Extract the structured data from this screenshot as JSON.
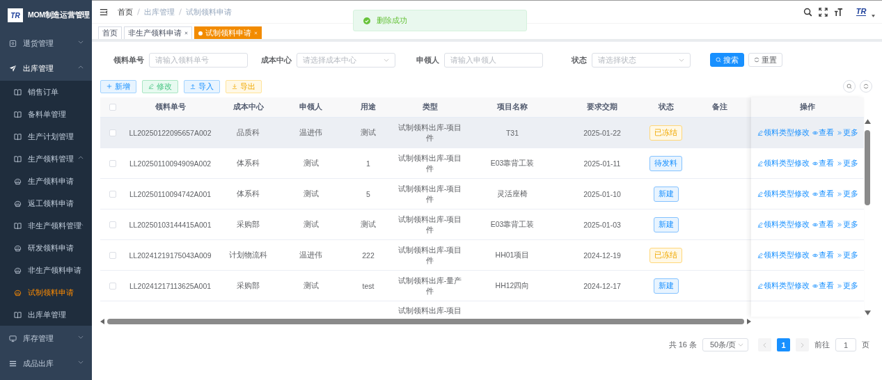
{
  "sidebar": {
    "logo_text": "TR",
    "title": "MOM制造运营管理",
    "items": [
      {
        "label": "退货管理",
        "expanded": false,
        "selected": false
      },
      {
        "label": "出库管理",
        "expanded": true,
        "selected": false,
        "children": [
          {
            "label": "销售订单",
            "selected": false
          },
          {
            "label": "备料单管理",
            "selected": false
          },
          {
            "label": "生产计划管理",
            "selected": false
          },
          {
            "label": "生产领料管理",
            "expanded": true,
            "selected": false,
            "children": [
              {
                "label": "生产领料申请",
                "selected": false
              },
              {
                "label": "返工领料申请",
                "selected": false
              }
            ]
          },
          {
            "label": "非生产领料管理",
            "expanded": true,
            "selected": false,
            "children": [
              {
                "label": "研发领料申请",
                "selected": false
              },
              {
                "label": "非生产领料申请",
                "selected": false
              },
              {
                "label": "试制领料申请",
                "selected": true
              }
            ]
          },
          {
            "label": "出库单管理",
            "selected": false
          }
        ]
      },
      {
        "label": "库存管理",
        "expanded": false,
        "selected": false
      },
      {
        "label": "成品出库",
        "expanded": false,
        "selected": false
      }
    ]
  },
  "header": {
    "breadcrumbs": [
      "首页",
      "出库管理",
      "试制领料申请"
    ],
    "avatar_text": "TR"
  },
  "tags": [
    {
      "label": "首页",
      "closable": false,
      "selected": false
    },
    {
      "label": "非生产领料申请",
      "closable": true,
      "selected": false
    },
    {
      "label": "试制领料申请",
      "closable": true,
      "selected": true
    }
  ],
  "toast": {
    "message": "删除成功"
  },
  "filters": [
    {
      "label": "领料单号",
      "kind": "input",
      "placeholder": "请输入领料单号"
    },
    {
      "label": "成本中心",
      "kind": "select",
      "placeholder": "请选择成本中心"
    },
    {
      "label": "申领人",
      "kind": "input",
      "placeholder": "请输入申领人"
    },
    {
      "label": "状态",
      "kind": "select",
      "placeholder": "请选择状态"
    }
  ],
  "filter_buttons": [
    {
      "label": "搜索",
      "kind": "primary"
    },
    {
      "label": "重置",
      "kind": "default"
    }
  ],
  "toolbar": [
    {
      "label": "新增",
      "kind": "add"
    },
    {
      "label": "修改",
      "kind": "edit"
    },
    {
      "label": "导入",
      "kind": "import"
    },
    {
      "label": "导出",
      "kind": "export"
    }
  ],
  "table": {
    "all_checked": false,
    "columns": [
      "领料单号",
      "成本中心",
      "申领人",
      "用途",
      "类型",
      "项目名称",
      "要求交期",
      "状态",
      "备注",
      "操作"
    ],
    "rows": [
      {
        "checked": false,
        "highlighted": true,
        "code": "LL20250122095657A002",
        "cost_center": "品质科",
        "applicant": "温进伟",
        "use": "测试",
        "type": "试制领料出库-项目件",
        "project": "T31",
        "due": "2025-01-22",
        "status": {
          "text": "已冻结",
          "kind": "warning"
        },
        "actions": [
          "领料类型修改",
          "查看",
          "更多"
        ]
      },
      {
        "checked": false,
        "highlighted": false,
        "code": "LL20250110094909A002",
        "cost_center": "体系科",
        "applicant": "测试",
        "use": "1",
        "type": "试制领料出库-项目件",
        "project": "E03靠背工装",
        "due": "2025-01-11",
        "status": {
          "text": "待发料",
          "kind": "primary"
        },
        "actions": [
          "领料类型修改",
          "查看",
          "更多"
        ]
      },
      {
        "checked": false,
        "highlighted": false,
        "code": "LL20250110094742A001",
        "cost_center": "体系科",
        "applicant": "测试",
        "use": "5",
        "type": "试制领料出库-项目件",
        "project": "灵活座椅",
        "due": "2025-01-10",
        "status": {
          "text": "新建",
          "kind": "primary"
        },
        "actions": [
          "领料类型修改",
          "查看",
          "更多"
        ]
      },
      {
        "checked": false,
        "highlighted": false,
        "code": "LL20250103144415A001",
        "cost_center": "采购部",
        "applicant": "测试",
        "use": "测试",
        "type": "试制领料出库-项目件",
        "project": "E03靠背工装",
        "due": "2025-01-03",
        "status": {
          "text": "新建",
          "kind": "primary"
        },
        "actions": [
          "领料类型修改",
          "查看",
          "更多"
        ]
      },
      {
        "checked": false,
        "highlighted": false,
        "code": "LL20241219175043A009",
        "cost_center": "计划物流科",
        "applicant": "温进伟",
        "use": "222",
        "type": "试制领料出库-项目件",
        "project": "HH01项目",
        "due": "2024-12-19",
        "status": {
          "text": "已冻结",
          "kind": "warning"
        },
        "actions": [
          "领料类型修改",
          "查看",
          "更多"
        ]
      },
      {
        "checked": false,
        "highlighted": false,
        "code": "LL20241217113625A001",
        "cost_center": "采购部",
        "applicant": "测试",
        "use": "test",
        "type": "试制领料出库-量产件",
        "project": "HH12四向",
        "due": "2024-12-17",
        "status": {
          "text": "新建",
          "kind": "primary"
        },
        "actions": [
          "领料类型修改",
          "查看",
          "更多"
        ]
      },
      {
        "type": "试制领料出库-项目"
      }
    ]
  },
  "pagination": {
    "total": "共 16 条",
    "page_size": "50条/页",
    "pages": [
      {
        "label": "1",
        "selected": true
      }
    ],
    "goto_label": "前往",
    "goto_value": "1",
    "goto_suffix": "页"
  }
}
